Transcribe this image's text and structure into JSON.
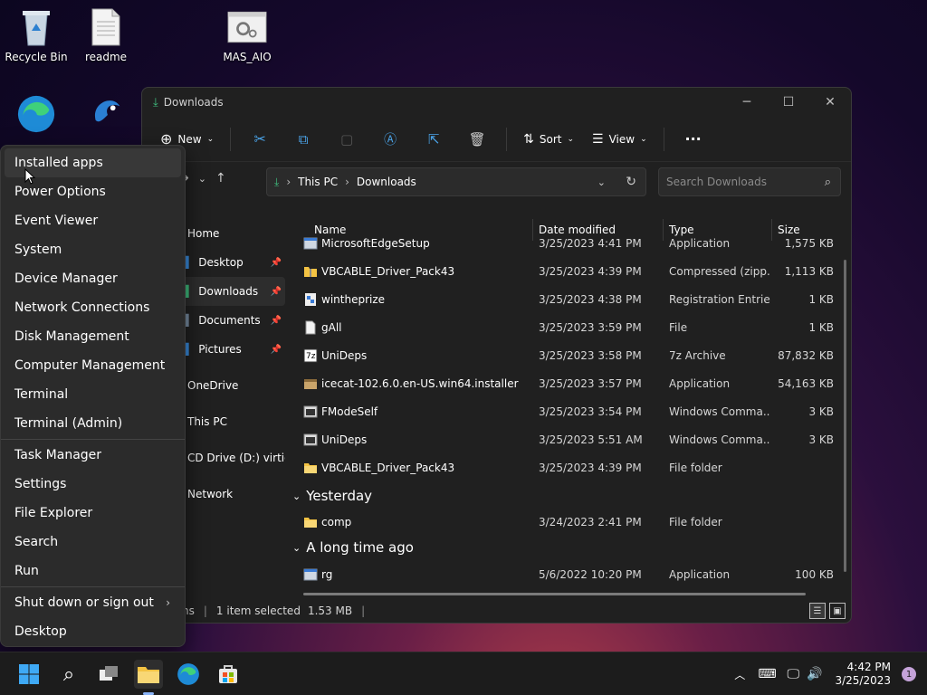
{
  "desktop": {
    "icons": [
      {
        "label": "Recycle Bin"
      },
      {
        "label": "readme"
      },
      {
        "label": "MAS_AIO"
      }
    ]
  },
  "explorer": {
    "title": "Downloads",
    "toolbar": {
      "new_label": "New",
      "sort_label": "Sort",
      "view_label": "View"
    },
    "address": {
      "crumb1": "This PC",
      "crumb2": "Downloads"
    },
    "search_placeholder": "Search Downloads",
    "sidebar": [
      {
        "label": "Home",
        "pinned": false
      },
      {
        "label": "Desktop",
        "pinned": true
      },
      {
        "label": "Downloads",
        "pinned": true
      },
      {
        "label": "Documents",
        "pinned": true
      },
      {
        "label": "Pictures",
        "pinned": true
      },
      {
        "label": "OneDrive",
        "pinned": false
      },
      {
        "label": "This PC",
        "pinned": false
      },
      {
        "label": "CD Drive (D:) virtio-w",
        "pinned": false
      },
      {
        "label": "Network",
        "pinned": false
      }
    ],
    "columns": {
      "name": "Name",
      "date": "Date modified",
      "type": "Type",
      "size": "Size"
    },
    "groups": {
      "yesterday": "Yesterday",
      "long_ago": "A long time ago"
    },
    "files_today": [
      {
        "name": "MicrosoftEdgeSetup",
        "date": "3/25/2023 4:41 PM",
        "type": "Application",
        "size": "1,575 KB",
        "icon": "app-icon"
      },
      {
        "name": "VBCABLE_Driver_Pack43",
        "date": "3/25/2023 4:39 PM",
        "type": "Compressed (zipp...",
        "size": "1,113 KB",
        "icon": "zip-icon"
      },
      {
        "name": "wintheprize",
        "date": "3/25/2023 4:38 PM",
        "type": "Registration Entries",
        "size": "1 KB",
        "icon": "registry-icon"
      },
      {
        "name": "gAll",
        "date": "3/25/2023 3:59 PM",
        "type": "File",
        "size": "1 KB",
        "icon": "file-icon"
      },
      {
        "name": "UniDeps",
        "date": "3/25/2023 3:58 PM",
        "type": "7z Archive",
        "size": "87,832 KB",
        "icon": "archive-icon"
      },
      {
        "name": "icecat-102.6.0.en-US.win64.installer",
        "date": "3/25/2023 3:57 PM",
        "type": "Application",
        "size": "54,163 KB",
        "icon": "installer-icon"
      },
      {
        "name": "FModeSelf",
        "date": "3/25/2023 3:54 PM",
        "type": "Windows Comma...",
        "size": "3 KB",
        "icon": "cmd-icon"
      },
      {
        "name": "UniDeps",
        "date": "3/25/2023 5:51 AM",
        "type": "Windows Comma...",
        "size": "3 KB",
        "icon": "cmd-icon"
      },
      {
        "name": "VBCABLE_Driver_Pack43",
        "date": "3/25/2023 4:39 PM",
        "type": "File folder",
        "size": "",
        "icon": "folder-icon"
      }
    ],
    "files_yesterday": [
      {
        "name": "comp",
        "date": "3/24/2023 2:41 PM",
        "type": "File folder",
        "size": "",
        "icon": "folder-icon"
      }
    ],
    "files_long_ago": [
      {
        "name": "rg",
        "date": "5/6/2022 10:20 PM",
        "type": "Application",
        "size": "100 KB",
        "icon": "app-icon"
      }
    ],
    "status": {
      "count_fragment": "ns",
      "selected": "1 item selected",
      "selected_size": "1.53 MB"
    }
  },
  "context_menu": {
    "items_top": [
      "Installed apps",
      "Power Options",
      "Event Viewer",
      "System",
      "Device Manager",
      "Network Connections",
      "Disk Management",
      "Computer Management",
      "Terminal",
      "Terminal (Admin)"
    ],
    "items_mid": [
      "Task Manager",
      "Settings",
      "File Explorer",
      "Search",
      "Run"
    ],
    "shutdown": "Shut down or sign out",
    "desktop": "Desktop"
  },
  "taskbar": {
    "time": "4:42 PM",
    "date": "3/25/2023",
    "notifications": "1"
  },
  "colors": {
    "accent": "#0078d4",
    "folder": "#f4c343",
    "window_bg": "#202020",
    "menu_bg": "#2b2b2b"
  }
}
